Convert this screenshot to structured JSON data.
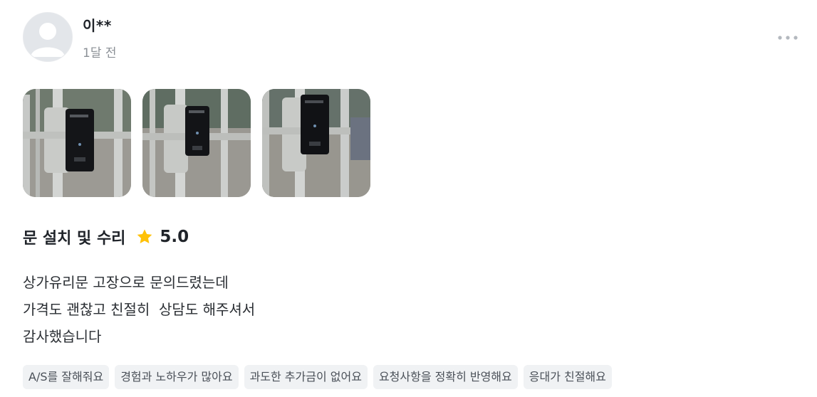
{
  "author": {
    "name": "이**",
    "time": "1달 전"
  },
  "photos": [
    {
      "icon": "door-lock-photo"
    },
    {
      "icon": "door-lock-photo"
    },
    {
      "icon": "door-lock-photo"
    }
  ],
  "review": {
    "service": "문 설치 및 수리",
    "rating": "5.0",
    "star_color": "#ffc107",
    "lines": [
      "상가유리문 고장으로 문의드렸는데",
      "가격도 괜찮고 친절히  상담도 해주셔서",
      "감사했습니다"
    ]
  },
  "tags": [
    "A/S를 잘해줘요",
    "경험과 노하우가 많아요",
    "과도한 추가금이 없어요",
    "요청사항을 정확히 반영해요",
    "응대가 친절해요"
  ],
  "more_icon": "more-horizontal-icon"
}
